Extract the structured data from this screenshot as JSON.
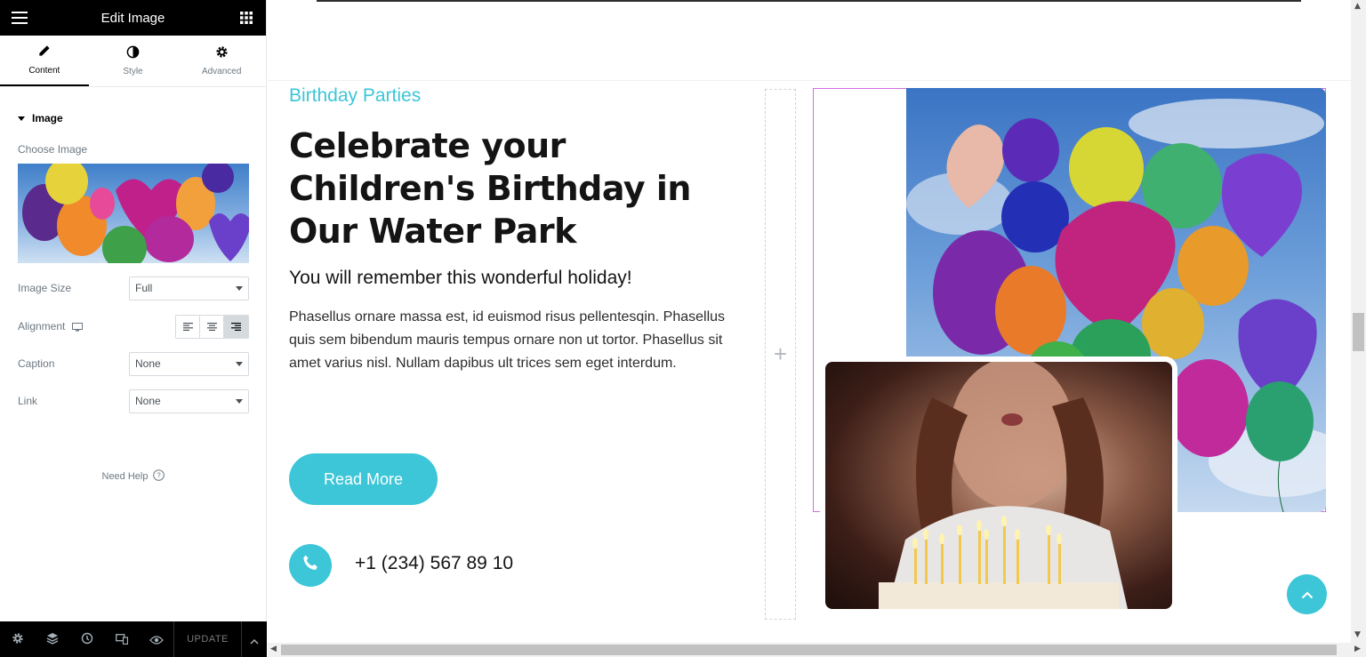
{
  "panel": {
    "title": "Edit Image",
    "tabs": [
      {
        "label": "Content",
        "icon": "pencil-icon"
      },
      {
        "label": "Style",
        "icon": "half-circle-icon"
      },
      {
        "label": "Advanced",
        "icon": "gear-icon"
      }
    ],
    "section_title": "Image",
    "choose_image_label": "Choose Image",
    "image_size": {
      "label": "Image Size",
      "value": "Full"
    },
    "alignment": {
      "label": "Alignment",
      "selected": "right"
    },
    "caption": {
      "label": "Caption",
      "value": "None"
    },
    "link": {
      "label": "Link",
      "value": "None"
    },
    "need_help": "Need Help",
    "footer": {
      "update_label": "UPDATE"
    }
  },
  "preview": {
    "subtitle": "Birthday Parties",
    "heading": "Celebrate your Children's Birthday in Our Water Park",
    "subheading": "You will remember this wonderful holiday!",
    "paragraph": "Phasellus ornare massa est, id euismod risus pellentesqin. Phasellus quis sem bibendum mauris tempus ornare non ut tortor. Phasellus sit amet varius nisl. Nullam dapibus ult trices sem eget interdum.",
    "button_label": "Read More",
    "phone": "+1 (234) 567 89 10"
  },
  "colors": {
    "accent": "#3cc6d8",
    "heading": "#141414",
    "panel_header": "#000000",
    "selection_border": "#d36fe0"
  }
}
